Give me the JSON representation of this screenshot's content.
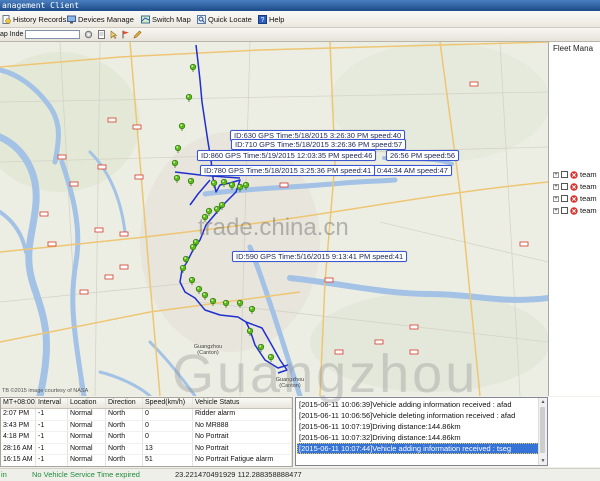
{
  "window": {
    "title": "anagement Client"
  },
  "menu": {
    "history_records": "History Records",
    "devices_manage": "Devices Manage",
    "switch_map": "Switch Map",
    "quick_locate": "Quick Locate",
    "help": "Help"
  },
  "toolbar": {
    "label": "ap Inde",
    "search_value": ""
  },
  "map": {
    "tooltips": [
      "ID:630 GPS Time:5/18/2015 3:26:30 PM speed:40",
      "ID:710 GPS Time:5/18/2015 3:26:36 PM speed:57",
      "26:56 PM speed:56",
      "ID:860 GPS Time:5/19/2015 12:03:35 PM speed:46",
      "0:44:34 AM speed:47",
      "ID:780 GPS Time:5/18/2015 3:25:36 PM speed:41",
      "ID:590 GPS Time:5/16/2015 9:13:41 PM speed:41"
    ],
    "labels": [
      {
        "line1": "Guangzhou",
        "line2": "(Canton)"
      },
      {
        "line1": "Guangzhou",
        "line2": "(Canton)"
      }
    ],
    "copyright": "TB ©2015 image courtesy of NASA",
    "track_color": "#1f2fd0",
    "marker_color": "#5cbc1c"
  },
  "watermarks": {
    "site": "trade.china.cn",
    "city": "Guangzhou"
  },
  "fleet_panel": {
    "title": "Fleet Mana",
    "items": [
      "team",
      "team",
      "team",
      "team"
    ]
  },
  "records_table": {
    "columns": [
      "MT+08:00)",
      "Interval",
      "Location",
      "Direction",
      "Speed(km/h)",
      "Vehicle Status"
    ],
    "rows": [
      [
        "2:07 PM",
        "-1",
        "Normal",
        "North",
        "0",
        "Ridder alarm"
      ],
      [
        "3:43 PM",
        "-1",
        "Normal",
        "North",
        "0",
        "No MR888"
      ],
      [
        "4:18 PM",
        "-1",
        "Normal",
        "North",
        "0",
        "No Portrait"
      ],
      [
        "28:16 AM",
        "-1",
        "Normal",
        "North",
        "13",
        "No Portrait"
      ],
      [
        "16:15 AM",
        "-1",
        "Normal",
        "North",
        "51",
        "No Portrait Fatigue alarm"
      ]
    ]
  },
  "log": {
    "entries": [
      "[2015-06-11 10:06:39]Vehicle adding information received : afad",
      "[2015-06-11 10:06:56]Vehicle deleting information received : afad",
      "[2015-06-11 10:07:19]Driving distance:144.86km",
      "[2015-06-11 10:07:32]Driving distance:144.86km",
      "[2015-06-11 10:07:44]Vehicle adding information received : tseg"
    ],
    "selected_index": 4
  },
  "status": {
    "prefix": "in",
    "message": "No Vehicle Service Time expired",
    "coords": "23.221470491929 112.288358888477"
  },
  "colors": {
    "title_bar": "#1c4a8a",
    "selection": "#3673d6",
    "status_text": "#1f8c3a",
    "alarm_icon": "#d9322d"
  }
}
